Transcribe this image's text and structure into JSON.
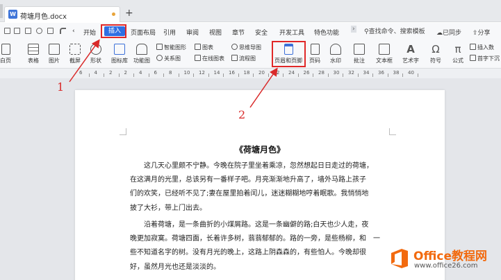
{
  "tabbar": {
    "doc_name": "荷塘月色.docx",
    "new_tab": "+"
  },
  "menu": {
    "items": [
      "开始",
      "插入",
      "页面布局",
      "引用",
      "审阅",
      "视图",
      "章节",
      "安全",
      "开发工具",
      "特色功能"
    ],
    "active": "插入",
    "search_label": "查找命令、搜索模板",
    "sync_label": "已同步",
    "share_label": "分享"
  },
  "ribbon": {
    "page_label": "白页",
    "table_label": "表格",
    "picture_label": "图片",
    "screenshot_label": "截屏",
    "shape_label": "形状",
    "iconlib_label": "图标库",
    "function_label": "功能图",
    "smartart_label": "智能图形",
    "chart_label": "图表",
    "mindmap_label": "思维导图",
    "relation_label": "关系图",
    "onlinechart_label": "在线图表",
    "flowchart_label": "流程图",
    "header_footer_label": "页眉和页脚",
    "pagenum_label": "页码",
    "watermark_label": "水印",
    "comment_label": "批注",
    "textbox_label": "文本框",
    "arttext_label": "艺术字",
    "symbol_label": "符号",
    "formula_label": "公式",
    "insert_num_label": "插入数",
    "first_letter_label": "首字下沉"
  },
  "ruler": {
    "labels": [
      "6",
      "4",
      "2",
      "2",
      "4",
      "6",
      "8",
      "10",
      "12",
      "14",
      "16",
      "18",
      "20",
      "22",
      "24",
      "26",
      "28",
      "30",
      "32",
      "34",
      "36",
      "38",
      "40"
    ]
  },
  "document": {
    "title": "《荷塘月色》",
    "paragraphs": [
      [
        "　　这几天心里颇不宁静。今晚在院子里坐着乘凉，忽然想起日日走过的荷塘，",
        "在这满月的光里，总该另有一番样子吧。月亮渐渐地升高了，墙外马路上孩子",
        "们的欢笑，已经听不见了;妻在屋里拍着闰儿，迷迷糊糊地哼着眠歌。我悄悄地",
        "披了大衫，带上门出去。"
      ],
      [
        "　　沿着荷塘，是一条曲折的小煤屑路。这是一条幽僻的路;白天也少人走，夜",
        "晚更加寂寞。荷塘四面，长着许多树，蓊蓊郁郁的。路的一旁，是些杨柳，和　一",
        "些不知道名字的树。没有月光的晚上，这路上阴森森的，有些怕人。今晚却很",
        "好，虽然月光也还是淡淡的。"
      ]
    ]
  },
  "annotations": {
    "step1": "1",
    "step2": "2",
    "color": "#d92a2a"
  },
  "watermark": {
    "brand": "Office教程网",
    "url": "www.office26.com"
  }
}
